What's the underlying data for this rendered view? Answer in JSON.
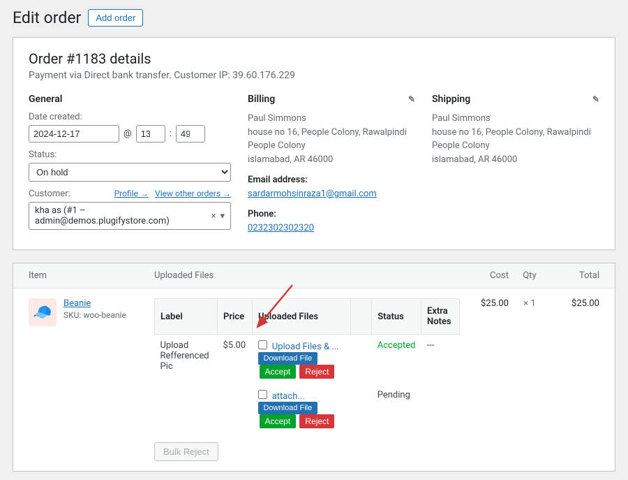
{
  "header": {
    "title": "Edit order",
    "add_button": "Add order"
  },
  "order": {
    "title": "Order #1183 details",
    "sub": "Payment via Direct bank transfer. Customer IP: 39.60.176.229"
  },
  "general": {
    "heading": "General",
    "date_label": "Date created:",
    "date_value": "2024-12-17",
    "at": "@",
    "hour": "13",
    "minute": "49",
    "status_label": "Status:",
    "status_value": "On hold",
    "customer_label": "Customer:",
    "profile_link": "Profile →",
    "other_orders_link": "View other orders →",
    "customer_value": "kha as (#1 – admin@demos.plugifystore.com)"
  },
  "billing": {
    "heading": "Billing",
    "name": "Paul Simmons",
    "line1": "house no 16, People Colony, Rawalpindi",
    "line2": "People Colony",
    "line3": "islamabad, AR 46000",
    "email_label": "Email address:",
    "email": "sardarmohsinraza1@gmail.com",
    "phone_label": "Phone:",
    "phone": "0232302302320"
  },
  "shipping": {
    "heading": "Shipping",
    "name": "Paul Simmons",
    "line1": "house no 16, People Colony, Rawalpindi",
    "line2": "People Colony",
    "line3": "islamabad, AR 46000"
  },
  "items_header": {
    "item": "Item",
    "files": "Uploaded Files",
    "cost": "Cost",
    "qty": "Qty",
    "total": "Total"
  },
  "product": {
    "name": "Beanie",
    "sku_label": "SKU:",
    "sku": "woo-beanie",
    "cost": "$25.00",
    "qty_prefix": "×",
    "qty": "1",
    "total": "$25.00"
  },
  "files_table": {
    "th_label": "Label",
    "th_price": "Price",
    "th_files": "Uploaded Files",
    "th_status": "Status",
    "th_notes": "Extra Notes",
    "row_label": "Upload Refferenced Pic",
    "row_price": "$5.00",
    "file1": "Upload Files & ...",
    "file2": "attach...",
    "download": "Download File",
    "accept": "Accept",
    "reject": "Reject",
    "status1": "Accepted",
    "status2": "Pending",
    "notes": "---",
    "bulk_reject": "Bulk Reject"
  }
}
